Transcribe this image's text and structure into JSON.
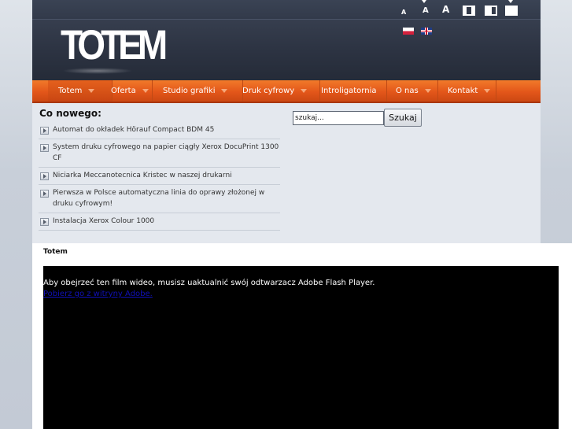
{
  "header": {
    "logo_text": "TOTEM",
    "font_sizes": [
      "A",
      "A",
      "A"
    ],
    "width_buttons": [
      "narrow",
      "medium",
      "wide"
    ],
    "languages": [
      {
        "code": "pl",
        "icon": "flag-pl-icon"
      },
      {
        "code": "en",
        "icon": "flag-uk-icon"
      }
    ]
  },
  "nav": {
    "items": [
      {
        "label": "Totem",
        "has_submenu": true
      },
      {
        "label": "Oferta",
        "has_submenu": true
      },
      {
        "label": "Studio grafiki",
        "has_submenu": true
      },
      {
        "label": "Druk cyfrowy",
        "has_submenu": true
      },
      {
        "label": "Introligatornia",
        "has_submenu": false
      },
      {
        "label": "O nas",
        "has_submenu": true
      },
      {
        "label": "Kontakt",
        "has_submenu": true
      }
    ]
  },
  "news": {
    "title": "Co nowego:",
    "items": [
      "Automat do okładek Hörauf Compact BDM 45",
      "System druku cyfrowego na papier ciągły Xerox DocuPrint 1300 CF",
      "Niciarka Meccanotecnica Kristec w naszej drukarni",
      "Pierwsza w Polsce automatyczna linia do oprawy złożonej w druku cyfrowym!",
      "Instalacja Xerox Colour 1000"
    ]
  },
  "search": {
    "value": "szukaj...",
    "button_label": "Szukaj"
  },
  "video": {
    "title": "Totem",
    "flash_message": "Aby obejrzeć ten film wideo, musisz uaktualnić swój odtwarzacz Adobe Flash Player.",
    "link_text": "Pobierz go z witryny Adobe."
  },
  "colors": {
    "nav_orange": "#e3561a",
    "header_dark": "#2d3443",
    "page_bg": "#e4e8ee",
    "link_blue": "#1010b8"
  }
}
